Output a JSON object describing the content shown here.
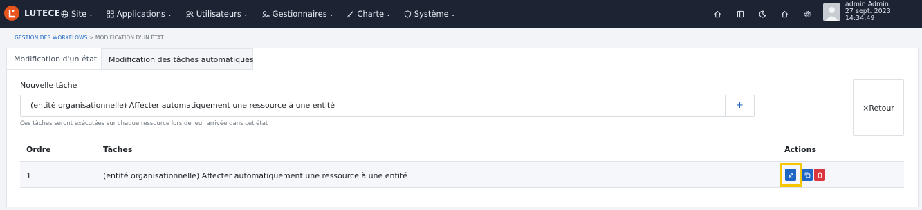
{
  "navbar": {
    "brand": "LUTECE",
    "brand_letter": "L",
    "menu": [
      {
        "label": "Site",
        "icon": "globe-icon"
      },
      {
        "label": "Applications",
        "icon": "apps-icon"
      },
      {
        "label": "Utilisateurs",
        "icon": "users-icon"
      },
      {
        "label": "Gestionnaires",
        "icon": "user-cog-icon"
      },
      {
        "label": "Charte",
        "icon": "brush-icon"
      },
      {
        "label": "Système",
        "icon": "shield-icon"
      }
    ],
    "right_icons": [
      "home-icon",
      "layout-icon",
      "moon-icon",
      "home-icon",
      "gear-icon"
    ],
    "user": {
      "name": "admin Admin",
      "datetime": "27 sept. 2023 14:34:49"
    }
  },
  "breadcrumb": {
    "parent": "GESTION DES WORKFLOWS",
    "separator": ">",
    "current": "MODIFICATION D'UN ÉTAT"
  },
  "tabs": [
    {
      "label": "Modification d'un état",
      "active": false
    },
    {
      "label": "Modification des tâches automatiques",
      "active": true
    }
  ],
  "form": {
    "new_task_label": "Nouvelle tâche",
    "selected_task": "(entité organisationnelle) Affecter automatiquement une ressource à une entité",
    "add_label": "+",
    "help": "Ces tâches seront exécutées sur chaque ressource lors de leur arrivée dans cet état"
  },
  "back_button": {
    "icon": "×",
    "label": "Retour"
  },
  "table": {
    "headers": {
      "order": "Ordre",
      "tasks": "Tâches",
      "actions": "Actions"
    },
    "rows": [
      {
        "order": "1",
        "task": "(entité organisationnelle) Affecter automatiquement une ressource à une entité"
      }
    ]
  },
  "colors": {
    "navbar": "#1c2333",
    "brand_accent": "#e8541e",
    "primary": "#1f66c4",
    "danger": "#d9363e",
    "highlight": "#f7c600"
  }
}
